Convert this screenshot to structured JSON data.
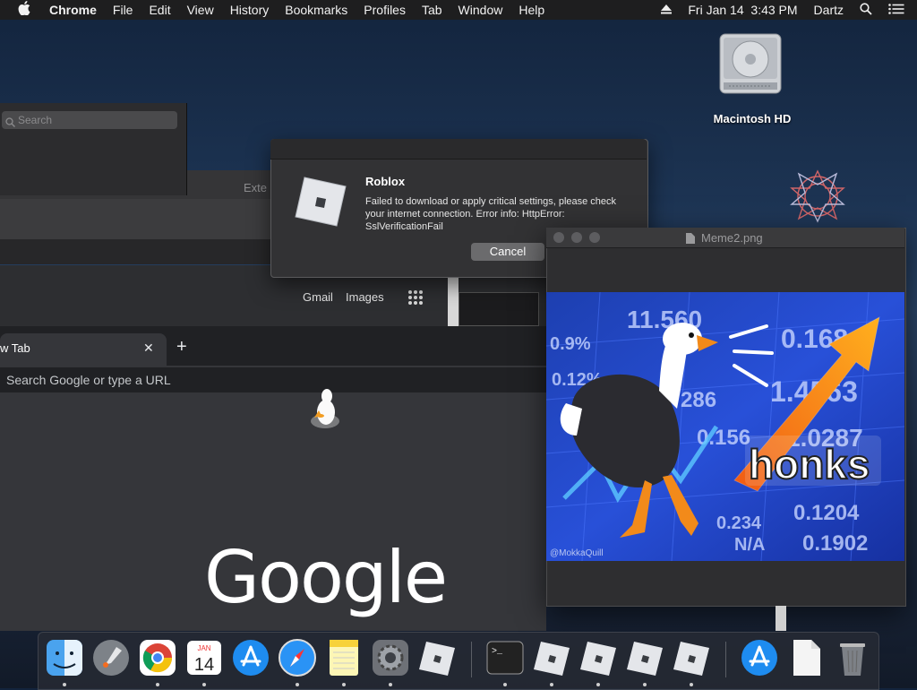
{
  "menubar": {
    "apple": "",
    "app_name": "Chrome",
    "items": [
      "File",
      "Edit",
      "View",
      "History",
      "Bookmarks",
      "Profiles",
      "Tab",
      "Window",
      "Help"
    ],
    "datetime": "Fri Jan 14  3:43 PM",
    "user": "Dartz"
  },
  "desktop": {
    "hd_label": "Macintosh HD"
  },
  "background_windows": {
    "search_placeholder": "Search",
    "ext_label": "Exte",
    "gmail": "Gmail",
    "images": "Images"
  },
  "chrome": {
    "tab_title": "w Tab",
    "tab_close": "✕",
    "new_tab": "+",
    "omnibox_placeholder": "Search Google or type a URL",
    "logo": "Google"
  },
  "alert": {
    "title": "Roblox",
    "message": "Failed to download or apply critical settings, please check your internet connection. Error info: HttpError: SslVerificationFail",
    "cancel_label": "Cancel"
  },
  "preview": {
    "title": "Meme2.png",
    "meme_caption": "honks",
    "meme_numbers": [
      "11.560",
      "0.168",
      "1.4563",
      "1.0287",
      "0.1204",
      "0.1902",
      "0.156",
      "0.234",
      "286",
      "0.12%",
      "0.9%",
      "N/A"
    ],
    "watermark": "@MokkaQuill"
  },
  "dock": {
    "calendar_month": "JAN",
    "calendar_day": "14"
  },
  "colors": {
    "menubar_bg": "#1e1e1f",
    "alert_bg": "#323234",
    "chrome_bg": "#35363a"
  }
}
